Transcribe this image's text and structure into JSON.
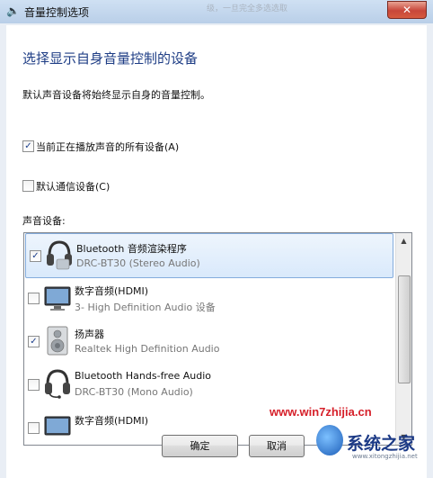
{
  "window": {
    "title": "音量控制选项",
    "close_glyph": "✕",
    "background_text": "级，一旦完全多选选取"
  },
  "heading": "选择显示自身音量控制的设备",
  "description": "默认声音设备将始终显示自身的音量控制。",
  "checkboxes": [
    {
      "label": "当前正在播放声音的所有设备(A)",
      "checked": true
    },
    {
      "label": "默认通信设备(C)",
      "checked": false
    }
  ],
  "device_list": {
    "label": "声音设备:",
    "items": [
      {
        "name": "Bluetooth 音频渲染程序",
        "sub": "DRC-BT30 (Stereo Audio)",
        "checked": true,
        "icon": "headset-icon",
        "selected": true
      },
      {
        "name": "数字音频(HDMI)",
        "sub": "3- High Definition Audio 设备",
        "checked": false,
        "icon": "monitor-icon",
        "selected": false
      },
      {
        "name": "扬声器",
        "sub": "Realtek High Definition Audio",
        "checked": true,
        "icon": "speaker-icon",
        "selected": false
      },
      {
        "name": "Bluetooth Hands-free Audio",
        "sub": "DRC-BT30 (Mono Audio)",
        "checked": false,
        "icon": "headset-mic-icon",
        "selected": false
      },
      {
        "name": "数字音频(HDMI)",
        "sub": "",
        "checked": false,
        "icon": "monitor-icon",
        "selected": false
      }
    ]
  },
  "buttons": {
    "ok": "确定",
    "cancel": "取消"
  },
  "watermark": {
    "url": "www.win7zhijia.cn",
    "logo_text": "系统之家",
    "logo_url": "www.xitongzhijia.net"
  },
  "colors": {
    "heading": "#1e3d85",
    "selection": "#d9e9fb",
    "watermark": "#d6202a"
  }
}
